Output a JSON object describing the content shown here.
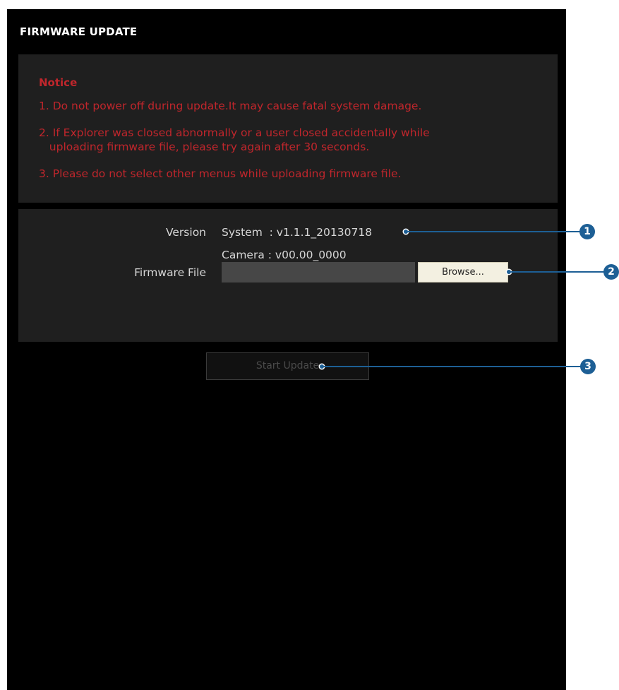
{
  "title": "FIRMWARE UPDATE",
  "notice": {
    "heading": "Notice",
    "item1": "1. Do not power off during update.It may cause fatal system damage.",
    "item2_line1": "2. If Explorer was closed abnormally or a user closed accidentally while",
    "item2_line2": "   uploading firmware file, please try again after 30 seconds.",
    "item3": "3. Please do not select other menus while uploading firmware file."
  },
  "version": {
    "label": "Version",
    "system": "System  : v1.1.1_20130718",
    "camera": "Camera : v00.00_0000"
  },
  "firmware_file": {
    "label": "Firmware File",
    "value": "",
    "browse_label": "Browse..."
  },
  "start_update_label": "Start Update",
  "callouts": [
    "1",
    "2",
    "3"
  ],
  "colors": {
    "notice_red": "#c0262c",
    "callout_blue": "#1d5f95"
  }
}
